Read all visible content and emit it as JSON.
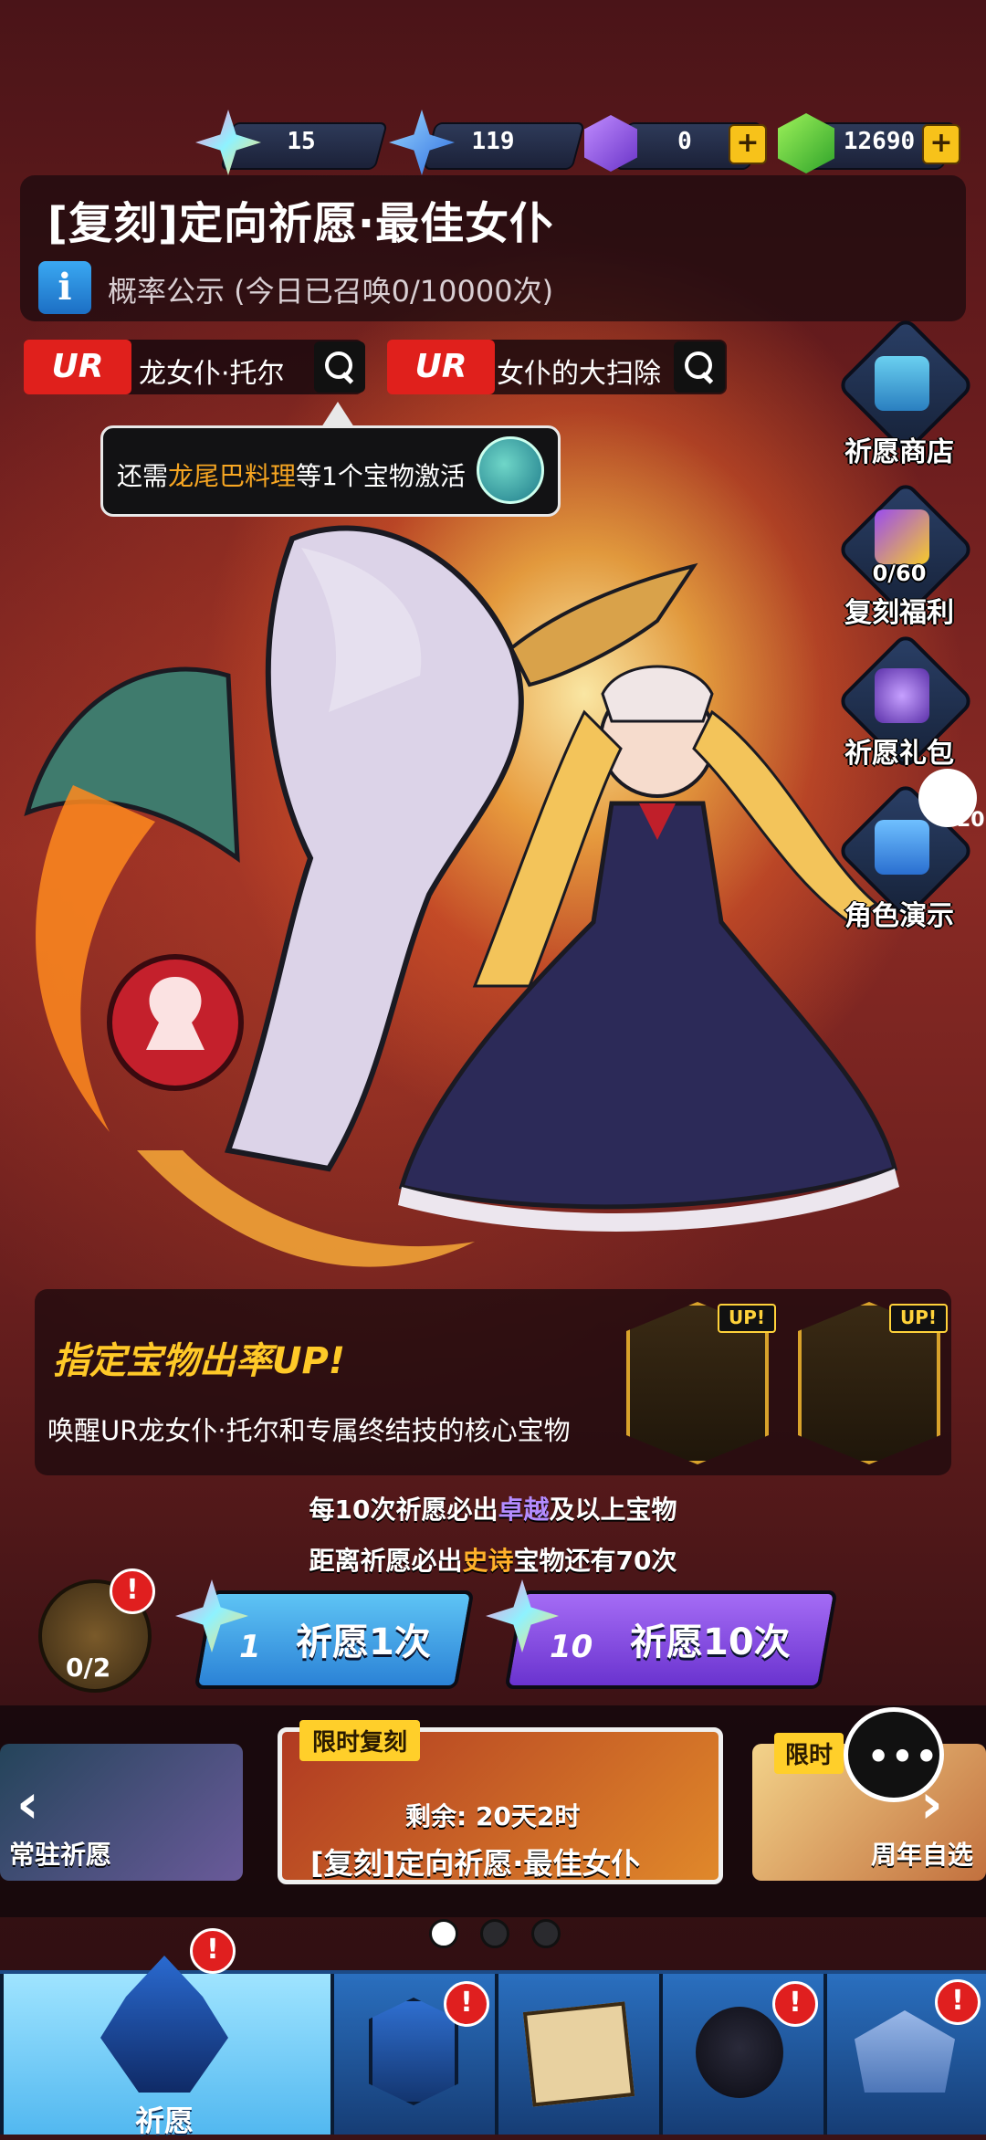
{
  "currencies": [
    {
      "icon": "rainbow-star-icon",
      "value": "15",
      "has_plus": false
    },
    {
      "icon": "blue-star-icon",
      "value": "119",
      "has_plus": false
    },
    {
      "icon": "purple-coin-icon",
      "value": "0",
      "has_plus": true
    },
    {
      "icon": "green-gem-icon",
      "value": "12690",
      "has_plus": true
    }
  ],
  "header": {
    "title": "[复刻]定向祈愿·最佳女仆",
    "prob_text": "概率公示 (今日已召唤0/10000次)",
    "info_glyph": "i"
  },
  "featured": [
    {
      "rarity": "UR",
      "name": "龙女仆·托尔"
    },
    {
      "rarity": "UR",
      "name": "女仆的大扫除"
    }
  ],
  "tooltip": {
    "pre": "还需",
    "highlight": "龙尾巴料理",
    "post": "等1个宝物激活"
  },
  "side_menu": [
    {
      "label": "祈愿商店",
      "icon": "treasure-chest-icon"
    },
    {
      "label": "复刻福利",
      "icon": "gold-cards-icon",
      "progress": "0/60"
    },
    {
      "label": "祈愿礼包",
      "icon": "gift-bag-icon"
    },
    {
      "label": "角色演示",
      "icon": "video-clapper-icon",
      "bubble_count": "20"
    }
  ],
  "rate_up": {
    "title": "指定宝物出率UP!",
    "desc": "唤醒UR龙女仆·托尔和专属终结技的核心宝物",
    "tag": "UP!",
    "items": [
      {
        "icon": "dragon-tail-dish-icon"
      },
      {
        "icon": "frying-pan-icon"
      }
    ]
  },
  "rules": {
    "line1_pre": "每10次祈愿必出",
    "line1_hl": "卓越",
    "line1_post": "及以上宝物",
    "line2_pre": "距离祈愿必出",
    "line2_hl": "史诗",
    "line2_post": "宝物还有70次"
  },
  "counter": {
    "value": "0/2",
    "badge": "!"
  },
  "pull_buttons": [
    {
      "count": "1",
      "label": "祈愿1次"
    },
    {
      "count": "10",
      "label": "祈愿10次"
    }
  ],
  "banners": [
    {
      "label": "常驻祈愿"
    },
    {
      "tag": "限时复刻",
      "remaining": "剩余: 20天2时",
      "label": "[复刻]定向祈愿·最佳女仆"
    },
    {
      "tag": "限时",
      "label": "周年自选"
    }
  ],
  "page_dots": {
    "count": 3,
    "active": 0
  },
  "bottom_nav": [
    {
      "label": "祈愿",
      "icon": "crystal-altar-icon",
      "active": true,
      "badge": "!"
    },
    {
      "label": "",
      "icon": "rune-shield-icon",
      "active": false,
      "badge": "!"
    },
    {
      "label": "",
      "icon": "treasure-map-icon",
      "active": false,
      "badge": ""
    },
    {
      "label": "",
      "icon": "shadow-creature-icon",
      "active": false,
      "badge": "!"
    },
    {
      "label": "",
      "icon": "guild-house-icon",
      "active": false,
      "badge": "!"
    }
  ]
}
